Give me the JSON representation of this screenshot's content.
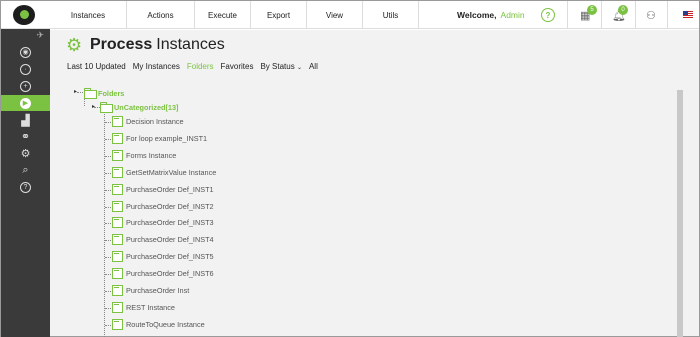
{
  "nav": {
    "menu": [
      "Instances",
      "Actions",
      "Execute",
      "Export",
      "View",
      "Utils"
    ],
    "welcome_label": "Welcome,",
    "user": "Admin",
    "help_icon": "?",
    "tasks_badge": "5",
    "notifications_badge": "0"
  },
  "page": {
    "title_bold": "Process",
    "title_rest": "Instances",
    "tabs": [
      "Last 10 Updated",
      "My Instances",
      "Folders",
      "Favorites",
      "By Status",
      "All"
    ],
    "active_tab": "Folders"
  },
  "tree": {
    "root_label": "Folders",
    "folder_label": "UnCategorized[13]",
    "items": [
      "Decision Instance",
      "For loop example_INST1",
      "Forms Instance",
      "GetSetMatrixValue Instance",
      "PurchaseOrder Def_INST1",
      "PurchaseOrder Def_INST2",
      "PurchaseOrder Def_INST3",
      "PurchaseOrder Def_INST4",
      "PurchaseOrder Def_INST5",
      "PurchaseOrder Def_INST6",
      "PurchaseOrder Inst",
      "REST Instance",
      "RouteToQueue Instance"
    ]
  },
  "sidebar": {
    "icons": [
      "pin-icon",
      "dashboard-icon",
      "api-icon",
      "add-icon",
      "play-icon",
      "chart-icon",
      "link-icon",
      "settings-icon",
      "search-icon",
      "help-icon"
    ],
    "active": "play-icon"
  },
  "colors": {
    "accent": "#7cc242",
    "sidebar": "#3a3a3a"
  }
}
